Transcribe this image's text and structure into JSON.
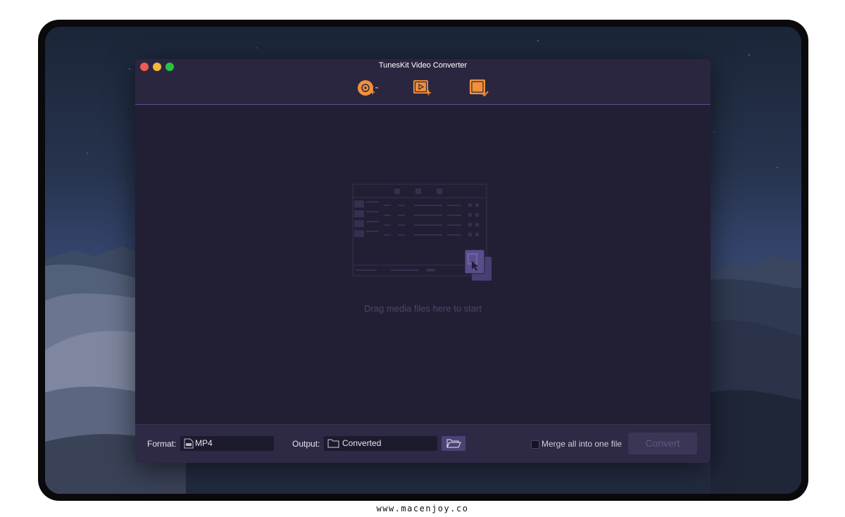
{
  "watermark": "www.macenjoy.co",
  "window": {
    "title": "TunesKit Video Converter"
  },
  "toolbar": {
    "buttons": [
      {
        "name": "add-dvd",
        "icon": "dvd-add-icon"
      },
      {
        "name": "add-files",
        "icon": "video-add-icon"
      },
      {
        "name": "converted-history",
        "icon": "converted-check-icon"
      }
    ]
  },
  "content": {
    "drop_hint": "Drag media files here to start"
  },
  "bottom": {
    "format_label": "Format:",
    "format_value": "MP4",
    "output_label": "Output:",
    "output_value": "Converted",
    "merge_label": "Merge all into one file",
    "merge_checked": false,
    "convert_label": "Convert"
  },
  "colors": {
    "accent": "#f0913a",
    "window_bg": "#221f34",
    "titlebar_bg": "#2a2640"
  }
}
